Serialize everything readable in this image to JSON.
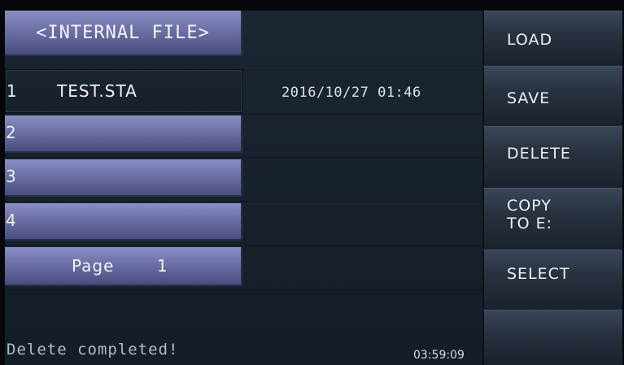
{
  "title": "<INTERNAL FILE>",
  "files": [
    {
      "num": "1",
      "name": "TEST.STA",
      "date": "2016/10/27 01:46"
    },
    {
      "num": "2",
      "name": "",
      "date": ""
    },
    {
      "num": "3",
      "name": "",
      "date": ""
    },
    {
      "num": "4",
      "name": "",
      "date": ""
    }
  ],
  "page": {
    "label": "Page",
    "number": "1"
  },
  "softkeys": {
    "load": "LOAD",
    "save": "SAVE",
    "delete": "DELETE",
    "copy_line1": "COPY",
    "copy_line2": "TO E:",
    "select": "SELECT",
    "blank": ""
  },
  "status": "Delete completed!",
  "clock": "03:59:09"
}
